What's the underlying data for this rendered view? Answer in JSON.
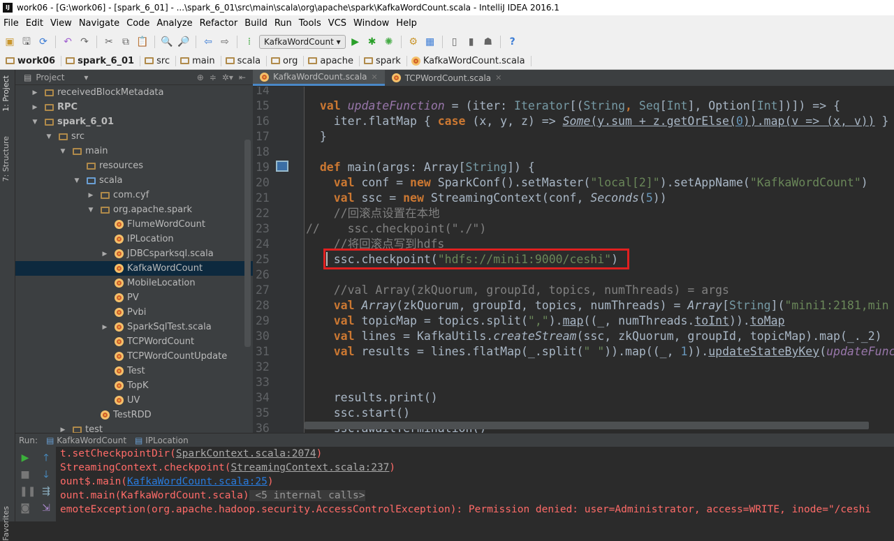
{
  "window": {
    "title": "work06 - [G:\\work06] - [spark_6_01] - ...\\spark_6_01\\src\\main\\scala\\org\\apache\\spark\\KafkaWordCount.scala - IntelliJ IDEA 2016.1",
    "logo": "IJ"
  },
  "menu": [
    "File",
    "Edit",
    "View",
    "Navigate",
    "Code",
    "Analyze",
    "Refactor",
    "Build",
    "Run",
    "Tools",
    "VCS",
    "Window",
    "Help"
  ],
  "toolbar": {
    "run_config": "KafkaWordCount ▾"
  },
  "breadcrumb": [
    "work06",
    "spark_6_01",
    "src",
    "main",
    "scala",
    "org",
    "apache",
    "spark",
    "KafkaWordCount.scala"
  ],
  "sidebar": {
    "project_tab": "1: Project",
    "structure_tab": "7: Structure",
    "favorites_tab": "Favorites"
  },
  "project": {
    "title": "Project",
    "tree": [
      {
        "label": "receivedBlockMetadata",
        "depth": 0,
        "arrow": "▶",
        "icon": "folder"
      },
      {
        "label": "RPC",
        "depth": 0,
        "arrow": "▶",
        "icon": "module",
        "bold": true
      },
      {
        "label": "spark_6_01",
        "depth": 0,
        "arrow": "▼",
        "icon": "module",
        "bold": true
      },
      {
        "label": "src",
        "depth": 1,
        "arrow": "▼",
        "icon": "folder"
      },
      {
        "label": "main",
        "depth": 2,
        "arrow": "▼",
        "icon": "folder"
      },
      {
        "label": "resources",
        "depth": 3,
        "arrow": "",
        "icon": "resources"
      },
      {
        "label": "scala",
        "depth": 3,
        "arrow": "▼",
        "icon": "source"
      },
      {
        "label": "com.cyf",
        "depth": 4,
        "arrow": "▶",
        "icon": "package"
      },
      {
        "label": "org.apache.spark",
        "depth": 4,
        "arrow": "▼",
        "icon": "package"
      },
      {
        "label": "FlumeWordCount",
        "depth": 5,
        "arrow": "",
        "icon": "object"
      },
      {
        "label": "IPLocation",
        "depth": 5,
        "arrow": "",
        "icon": "object"
      },
      {
        "label": "JDBCsparksql.scala",
        "depth": 5,
        "arrow": "▶",
        "icon": "object"
      },
      {
        "label": "KafkaWordCount",
        "depth": 5,
        "arrow": "",
        "icon": "object",
        "selected": true
      },
      {
        "label": "MobileLocation",
        "depth": 5,
        "arrow": "",
        "icon": "object"
      },
      {
        "label": "PV",
        "depth": 5,
        "arrow": "",
        "icon": "object"
      },
      {
        "label": "Pvbi",
        "depth": 5,
        "arrow": "",
        "icon": "object"
      },
      {
        "label": "SparkSqlTest.scala",
        "depth": 5,
        "arrow": "▶",
        "icon": "object"
      },
      {
        "label": "TCPWordCount",
        "depth": 5,
        "arrow": "",
        "icon": "object"
      },
      {
        "label": "TCPWordCountUpdate",
        "depth": 5,
        "arrow": "",
        "icon": "object"
      },
      {
        "label": "Test",
        "depth": 5,
        "arrow": "",
        "icon": "object"
      },
      {
        "label": "TopK",
        "depth": 5,
        "arrow": "",
        "icon": "object"
      },
      {
        "label": "UV",
        "depth": 5,
        "arrow": "",
        "icon": "object"
      },
      {
        "label": "TestRDD",
        "depth": 4,
        "arrow": "",
        "icon": "object"
      },
      {
        "label": "test",
        "depth": 2,
        "arrow": "▶",
        "icon": "folder"
      }
    ]
  },
  "editor": {
    "tabs": [
      {
        "label": "KafkaWordCount.scala",
        "active": true
      },
      {
        "label": "TCPWordCount.scala",
        "active": false
      }
    ],
    "lines": [
      {
        "n": "14",
        "tokens": []
      },
      {
        "n": "15",
        "tokens": [
          [
            "  ",
            ""
          ],
          [
            "val ",
            "k"
          ],
          [
            "updateFunction",
            "p"
          ],
          [
            " = (iter: ",
            ""
          ],
          [
            "Iterator",
            "t"
          ],
          [
            "[(",
            ""
          ],
          [
            "String",
            "t"
          ],
          [
            ", ",
            "k"
          ],
          [
            "Seq",
            "t"
          ],
          [
            "[",
            ""
          ],
          [
            "Int",
            "t"
          ],
          [
            "], ",
            ""
          ],
          [
            "Option[",
            ""
          ],
          [
            "Int",
            "t"
          ],
          [
            "])]) => {",
            ""
          ]
        ]
      },
      {
        "n": "16",
        "tokens": [
          [
            "    iter.flatMap { ",
            ""
          ],
          [
            "case ",
            "k"
          ],
          [
            "(x, y, z) => ",
            ""
          ],
          [
            "Some",
            "i u"
          ],
          [
            "(y.sum + z.getOrElse(",
            "u"
          ],
          [
            "0",
            "n u"
          ],
          [
            ")).map(v => (x, v))",
            "u"
          ],
          [
            " }",
            ""
          ]
        ]
      },
      {
        "n": "17",
        "tokens": [
          [
            "  }",
            ""
          ]
        ]
      },
      {
        "n": "18",
        "tokens": []
      },
      {
        "n": "19",
        "tokens": [
          [
            "  ",
            ""
          ],
          [
            "def ",
            "k"
          ],
          [
            "main(args: Array[",
            ""
          ],
          [
            "String",
            "t"
          ],
          [
            "]) {",
            ""
          ]
        ]
      },
      {
        "n": "20",
        "tokens": [
          [
            "    ",
            ""
          ],
          [
            "val ",
            "k"
          ],
          [
            "conf = ",
            ""
          ],
          [
            "new ",
            "k"
          ],
          [
            "SparkConf().setMaster(",
            ""
          ],
          [
            "\"local[2]\"",
            "s"
          ],
          [
            ").setAppName(",
            ""
          ],
          [
            "\"KafkaWordCount\"",
            "s"
          ],
          [
            ")",
            ""
          ]
        ]
      },
      {
        "n": "21",
        "tokens": [
          [
            "    ",
            ""
          ],
          [
            "val ",
            "k"
          ],
          [
            "ssc = ",
            ""
          ],
          [
            "new ",
            "k"
          ],
          [
            "StreamingContext(conf, ",
            ""
          ],
          [
            "Seconds",
            "i"
          ],
          [
            "(",
            ""
          ],
          [
            "5",
            "n"
          ],
          [
            "))",
            ""
          ]
        ]
      },
      {
        "n": "22",
        "tokens": [
          [
            "    //回滚点设置在本地",
            "c"
          ]
        ]
      },
      {
        "n": "23",
        "tokens": [
          [
            "//    ssc.checkpoint(\"./\")",
            "c"
          ]
        ]
      },
      {
        "n": "24",
        "tokens": [
          [
            "    //将回滚点写到hdfs",
            "c"
          ]
        ]
      },
      {
        "n": "25",
        "tokens": [
          [
            "    ssc.checkpoint(",
            ""
          ],
          [
            "\"hdfs://mini1:9000/ceshi\"",
            "s"
          ],
          [
            ")",
            ""
          ]
        ]
      },
      {
        "n": "26",
        "tokens": []
      },
      {
        "n": "27",
        "tokens": [
          [
            "    //val Array(zkQuorum, groupId, topics, numThreads) = args",
            "c"
          ]
        ]
      },
      {
        "n": "28",
        "tokens": [
          [
            "    ",
            ""
          ],
          [
            "val ",
            "k"
          ],
          [
            "Array",
            "i"
          ],
          [
            "(zkQuorum, groupId, topics, numThreads) = ",
            ""
          ],
          [
            "Array",
            "i"
          ],
          [
            "[",
            ""
          ],
          [
            "String",
            "t"
          ],
          [
            "](",
            ""
          ],
          [
            "\"mini1:2181,min",
            "s"
          ]
        ]
      },
      {
        "n": "29",
        "tokens": [
          [
            "    ",
            ""
          ],
          [
            "val ",
            "k"
          ],
          [
            "topicMap = topics.split(",
            ""
          ],
          [
            "\",\"",
            "s"
          ],
          [
            ").",
            ""
          ],
          [
            "map",
            "u"
          ],
          [
            "((_, numThreads.",
            ""
          ],
          [
            "toInt",
            "u"
          ],
          [
            ")).",
            ""
          ],
          [
            "toMap",
            "u"
          ]
        ]
      },
      {
        "n": "30",
        "tokens": [
          [
            "    ",
            ""
          ],
          [
            "val ",
            "k"
          ],
          [
            "lines = KafkaUtils.",
            ""
          ],
          [
            "createStream",
            "i"
          ],
          [
            "(ssc, zkQuorum, groupId, topicMap).map(_._2)",
            ""
          ]
        ]
      },
      {
        "n": "31",
        "tokens": [
          [
            "    ",
            ""
          ],
          [
            "val ",
            "k"
          ],
          [
            "results = lines.flatMap(_.split(",
            ""
          ],
          [
            "\" \"",
            "s"
          ],
          [
            ")).map((_, ",
            ""
          ],
          [
            "1",
            "n"
          ],
          [
            ")).",
            ""
          ],
          [
            "updateStateByKey",
            "u"
          ],
          [
            "(",
            ""
          ],
          [
            "updateFunc",
            "p"
          ]
        ]
      },
      {
        "n": "32",
        "tokens": []
      },
      {
        "n": "33",
        "tokens": []
      },
      {
        "n": "34",
        "tokens": [
          [
            "    results.print()",
            ""
          ]
        ]
      },
      {
        "n": "35",
        "tokens": [
          [
            "    ssc.start()",
            ""
          ]
        ]
      },
      {
        "n": "36",
        "tokens": [
          [
            "    ssc.awaitTermination()",
            ""
          ]
        ]
      }
    ]
  },
  "run": {
    "label": "Run:",
    "tabs": [
      "KafkaWordCount",
      "IPLocation"
    ],
    "console": [
      {
        "pre": "t.setCheckpointDir(",
        "link": "SparkContext.scala:2074",
        "post": ")"
      },
      {
        "pre": "StreamingContext.checkpoint(",
        "link": "StreamingContext.scala:237",
        "post": ")"
      },
      {
        "pre": "ount$.main(",
        "link": "KafkaWordCount.scala:25",
        "post": ")",
        "blue": true
      },
      {
        "pre": "ount.main(KafkaWordCount.scala)",
        "fold": " <5 internal calls>"
      },
      {
        "pre": "emoteException(org.apache.hadoop.security.AccessControlException): Permission denied: user=Administrator, access=WRITE, inode=\"/ceshi"
      }
    ]
  },
  "colors": {
    "highlight_box": "#e02020",
    "keyword": "#cc7832",
    "string": "#6a8759",
    "error": "#ff6b68"
  }
}
